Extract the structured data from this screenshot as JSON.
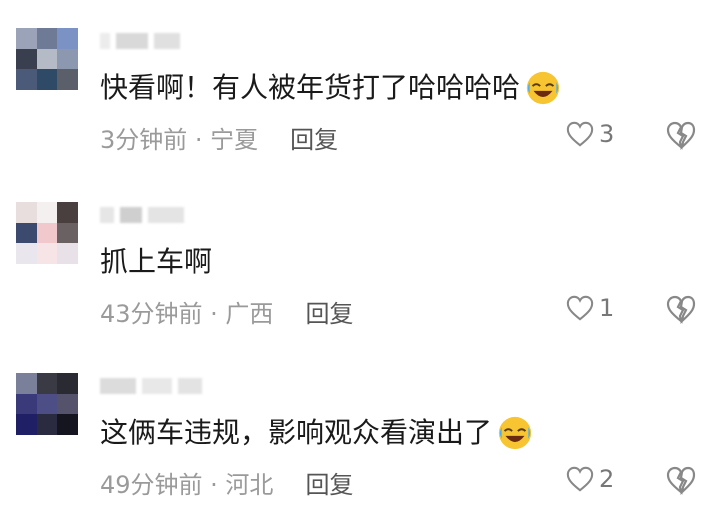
{
  "comments": [
    {
      "text": "快看啊！有人被年货打了哈哈哈哈",
      "emoji": "laughing-crying-emoji",
      "time_location": "3分钟前 · 宁夏",
      "reply_label": "回复",
      "likes": "3"
    },
    {
      "text": "抓上车啊",
      "emoji": "",
      "time_location": "43分钟前 · 广西",
      "reply_label": "回复",
      "likes": "1"
    },
    {
      "text": "这俩车违规，影响观众看演出了",
      "emoji": "laughing-crying-emoji",
      "time_location": "49分钟前 · 河北",
      "reply_label": "回复",
      "likes": "2"
    }
  ],
  "colors": {
    "text": "#1a1a1a",
    "meta": "#9a9a9a",
    "reply": "#555555",
    "icon": "#777777"
  }
}
